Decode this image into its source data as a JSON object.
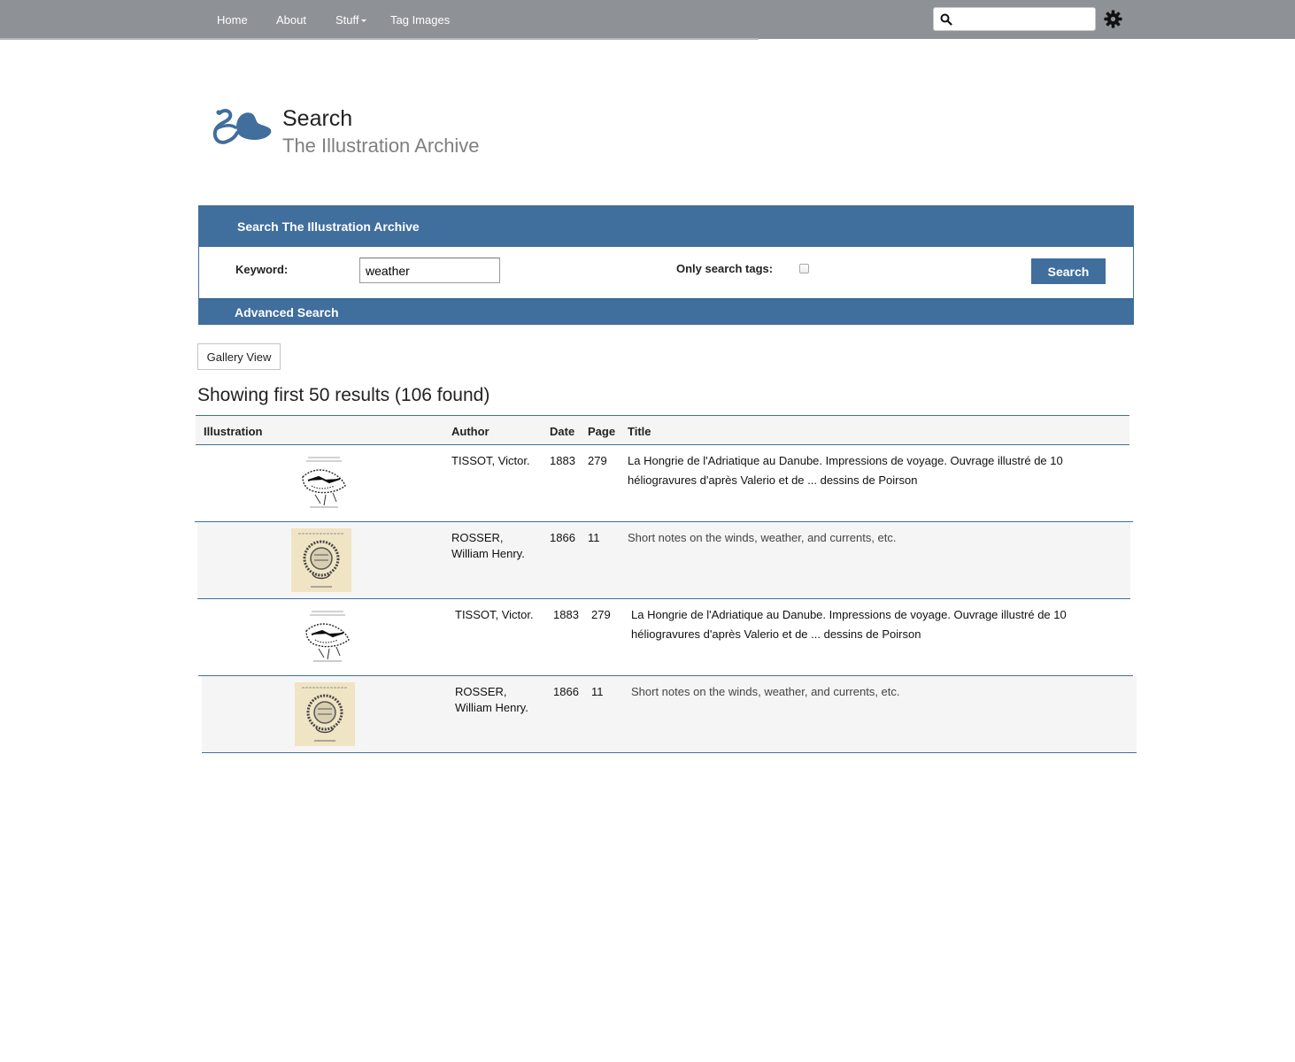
{
  "nav": {
    "items": [
      {
        "label": "Home"
      },
      {
        "label": "About"
      },
      {
        "label": "Stuff"
      },
      {
        "label": "Tag Images"
      }
    ],
    "search_value": ""
  },
  "header": {
    "title": "Search",
    "subtitle": "The Illustration Archive"
  },
  "search_panel": {
    "heading": "Search The Illustration Archive",
    "keyword_label": "Keyword:",
    "keyword_value": "weather",
    "tags_label": "Only search tags:",
    "tags_checked": false,
    "search_button": "Search",
    "advanced_label": "Advanced Search"
  },
  "gallery_button": "Gallery View",
  "results_heading": "Showing first 50 results (106 found)",
  "table": {
    "columns": [
      "Illustration",
      "Author",
      "Date",
      "Page",
      "Title"
    ],
    "rows": [
      {
        "author": "TISSOT, Victor.",
        "date": "1883",
        "page": "279",
        "title": "La Hongrie de l'Adriatique au Danube. Impressions de voyage. Ouvrage illustré de 10 héliogravures d'après Valerio et de ... dessins de Poirson",
        "thumb": "sketch-illustration"
      },
      {
        "author": "ROSSER, William Henry.",
        "date": "1866",
        "page": "11",
        "title": "Short notes on the winds, weather, and currents, etc.",
        "thumb": "wreath-emblem"
      },
      {
        "author": "TISSOT, Victor.",
        "date": "1883",
        "page": "279",
        "title": "La Hongrie de l'Adriatique au Danube. Impressions de voyage. Ouvrage illustré de 10 héliogravures d'après Valerio et de ... dessins de Poirson",
        "thumb": "sketch-illustration"
      },
      {
        "author": "ROSSER, William Henry.",
        "date": "1866",
        "page": "11",
        "title": "Short notes on the winds, weather, and currents, etc.",
        "thumb": "wreath-emblem"
      }
    ]
  },
  "colors": {
    "navbar": "#8e9196",
    "accent": "#406e9d",
    "row_alt": "#f5f5f5"
  }
}
